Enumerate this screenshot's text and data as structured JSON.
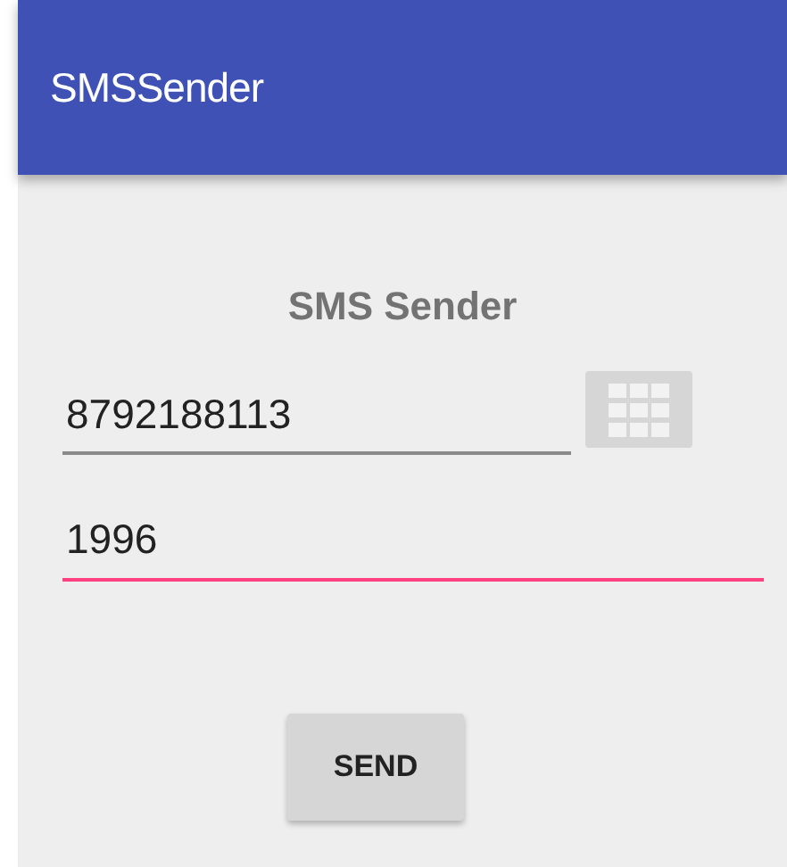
{
  "app_bar": {
    "title": "SMSSender"
  },
  "heading": "SMS Sender",
  "fields": [
    {
      "value": "8792188113",
      "focused": false
    },
    {
      "value": "1996",
      "focused": true
    }
  ],
  "send_button": {
    "label": "SEND"
  }
}
